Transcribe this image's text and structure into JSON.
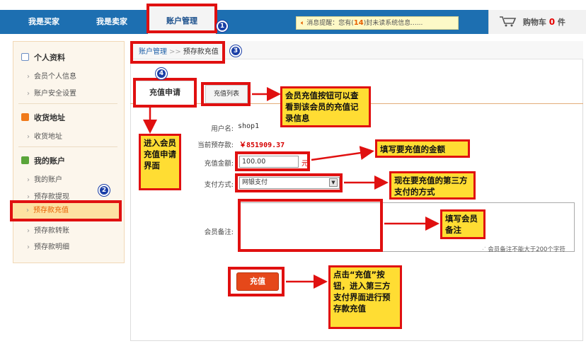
{
  "nav": {
    "tab_buyer": "我是买家",
    "tab_seller": "我是卖家",
    "tab_account": "账户管理",
    "notice_prefix": "消息提醒：您有(",
    "notice_count": "14",
    "notice_suffix": ")封未读系统信息......",
    "cart_label": "购物车",
    "cart_count": "0",
    "cart_unit": "件"
  },
  "sidebar": {
    "sec_profile": "个人资料",
    "item_member_info": "会员个人信息",
    "item_security": "账户安全设置",
    "sec_address": "收货地址",
    "item_address": "收货地址",
    "sec_account": "我的账户",
    "item_my_account": "我的账户",
    "item_withdraw": "预存款提现",
    "item_recharge": "预存款充值",
    "item_transfer": "预存款转账",
    "item_detail": "预存款明细"
  },
  "main": {
    "crumb_link": "账户管理",
    "crumb_sep": ">>",
    "crumb_current": "预存款充值",
    "tab_apply": "充值申请",
    "tab_list": "充值列表",
    "label_username": "用户名:",
    "username": "shop1",
    "label_balance": "当前预存款:",
    "balance": "￥851909.37",
    "label_amount": "充值金额:",
    "amount_value": "100.00",
    "amount_unit": "元",
    "label_payment": "支付方式:",
    "payment_value": "网银支付",
    "label_remark": "会员备注:",
    "remark_hint": "会员备注不能大于200个字符",
    "recharge_button": "充值"
  },
  "annotations": {
    "num1": "1",
    "num2": "2",
    "num3": "3",
    "num4": "4",
    "callout_list": "会员充值按钮可以查看到该会员的充值记录信息",
    "callout_apply": "进入会员充值申请界面",
    "callout_amount": "填写要充值的金额",
    "callout_payment": "现在要充值的第三方支付的方式",
    "callout_remark": "填写会员备注",
    "callout_button": "点击“充值”按钮，进入第三方支付界面进行预存款充值"
  },
  "colors": {
    "nav_blue": "#1d6fb1",
    "annotation_red": "#e01010",
    "callout_yellow": "#ffdd33",
    "active_orange": "#e66000"
  }
}
